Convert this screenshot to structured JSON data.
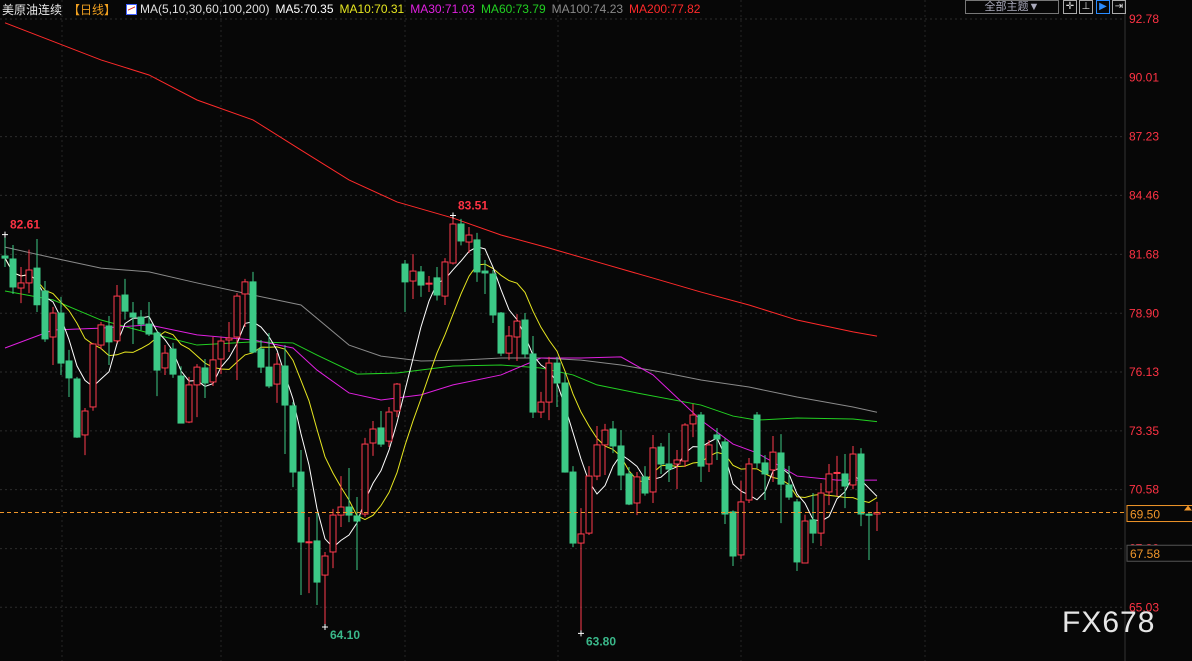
{
  "legend": {
    "title": "美原油连续",
    "period": "【日线】",
    "ma_params": "MA(5,10,30,60,100,200)",
    "ma5": "MA5:70.35",
    "ma10": "MA10:70.31",
    "ma30": "MA30:71.03",
    "ma60": "MA60:73.79",
    "ma100": "MA100:74.23",
    "ma200": "MA200:77.82"
  },
  "toolbar": {
    "themes": "全部主题▼",
    "icons": [
      "crosshair-icon",
      "range-icon",
      "play-forward-icon",
      "move-right-icon"
    ]
  },
  "watermark": "FX678",
  "colors": {
    "up": "#ff3b4e",
    "down": "#3cc986",
    "ma5": "#ffffff",
    "ma10": "#e6e620",
    "ma30": "#e020e0",
    "ma60": "#22d022",
    "ma100": "#8a8a8a",
    "ma200": "#ff2a2a",
    "last_price": "#f0962a",
    "axis": "#ff3344"
  },
  "chart_data": {
    "type": "candlestick",
    "title": "",
    "ylim": [
      63.5,
      92.78
    ],
    "y_ticks": [
      "92.78",
      "90.01",
      "87.23",
      "84.46",
      "81.68",
      "78.90",
      "76.13",
      "73.35",
      "70.58",
      "67.80",
      "65.03"
    ],
    "last_price": "69.50",
    "extra_price_label": "67.58",
    "annotations": {
      "high_left": "82.61",
      "high_mid": "83.51",
      "low_left": "64.10",
      "low_mid": "63.80"
    },
    "ohlc": [
      [
        81.6,
        82.61,
        81.08,
        81.5
      ],
      [
        81.46,
        82.12,
        79.81,
        80.14
      ],
      [
        80.09,
        81.08,
        79.38,
        80.33
      ],
      [
        80.33,
        81.9,
        79.85,
        80.94
      ],
      [
        81.03,
        82.4,
        78.96,
        79.3
      ],
      [
        79.95,
        80.42,
        77.55,
        77.69
      ],
      [
        77.78,
        79.2,
        76.46,
        78.91
      ],
      [
        78.91,
        79.67,
        75.99,
        76.55
      ],
      [
        76.65,
        77.17,
        74.95,
        75.85
      ],
      [
        75.8,
        75.9,
        73.02,
        73.06
      ],
      [
        73.16,
        74.43,
        72.21,
        74.29
      ],
      [
        74.48,
        77.5,
        74.3,
        77.45
      ],
      [
        77.4,
        78.49,
        77.2,
        78.35
      ],
      [
        78.3,
        78.77,
        76.46,
        77.55
      ],
      [
        77.6,
        80.23,
        77.5,
        79.71
      ],
      [
        79.76,
        80.52,
        78.6,
        79.0
      ],
      [
        78.91,
        79.43,
        77.45,
        78.72
      ],
      [
        78.72,
        79.05,
        78.1,
        78.39
      ],
      [
        78.39,
        79.43,
        77.83,
        77.92
      ],
      [
        77.97,
        78.1,
        74.99,
        76.22
      ],
      [
        76.32,
        77.4,
        75.99,
        77.02
      ],
      [
        77.21,
        77.5,
        75.85,
        76.03
      ],
      [
        75.94,
        76.4,
        73.7,
        73.72
      ],
      [
        73.77,
        75.9,
        73.72,
        75.52
      ],
      [
        75.52,
        76.5,
        74.0,
        76.36
      ],
      [
        76.32,
        76.74,
        74.9,
        75.61
      ],
      [
        75.66,
        77.78,
        75.47,
        76.7
      ],
      [
        76.74,
        77.78,
        76.03,
        77.59
      ],
      [
        77.64,
        78.49,
        77.07,
        77.73
      ],
      [
        77.78,
        79.85,
        75.75,
        79.71
      ],
      [
        79.81,
        80.52,
        78.25,
        80.38
      ],
      [
        80.38,
        80.85,
        77.02,
        77.07
      ],
      [
        77.21,
        77.64,
        76.08,
        76.36
      ],
      [
        76.36,
        77.97,
        75.37,
        75.47
      ],
      [
        75.56,
        77.02,
        74.67,
        76.5
      ],
      [
        76.41,
        77.4,
        72.26,
        74.57
      ],
      [
        74.53,
        74.71,
        70.7,
        71.41
      ],
      [
        71.41,
        72.45,
        65.61,
        68.11
      ],
      [
        68.08,
        69.29,
        65.7,
        68.12
      ],
      [
        68.16,
        69.48,
        65.14,
        66.22
      ],
      [
        66.55,
        67.64,
        64.1,
        67.45
      ],
      [
        67.64,
        69.67,
        66.88,
        69.38
      ],
      [
        69.38,
        71.22,
        68.82,
        69.76
      ],
      [
        69.76,
        71.6,
        69.05,
        69.38
      ],
      [
        69.34,
        70.23,
        66.79,
        69.1
      ],
      [
        69.43,
        73.02,
        69.3,
        72.73
      ],
      [
        72.78,
        73.82,
        72.17,
        73.44
      ],
      [
        73.49,
        74.29,
        72.6,
        72.73
      ],
      [
        72.87,
        74.48,
        72.59,
        74.24
      ],
      [
        74.29,
        75.61,
        74.0,
        75.56
      ],
      [
        81.22,
        81.41,
        78.96,
        80.38
      ],
      [
        80.42,
        81.69,
        79.57,
        80.89
      ],
      [
        80.85,
        81.13,
        79.67,
        80.23
      ],
      [
        80.28,
        80.66,
        79.9,
        80.32
      ],
      [
        80.57,
        81.08,
        79.5,
        79.76
      ],
      [
        79.71,
        81.5,
        79.29,
        81.32
      ],
      [
        81.27,
        83.51,
        81.2,
        83.11
      ],
      [
        83.11,
        83.35,
        82.1,
        82.31
      ],
      [
        82.26,
        82.97,
        81.74,
        82.59
      ],
      [
        82.36,
        82.69,
        80.38,
        80.85
      ],
      [
        80.89,
        81.41,
        79.81,
        80.8
      ],
      [
        80.75,
        80.94,
        78.44,
        78.82
      ],
      [
        78.91,
        78.96,
        76.88,
        77.02
      ],
      [
        77.02,
        78.3,
        76.69,
        77.83
      ],
      [
        77.78,
        78.86,
        76.65,
        78.53
      ],
      [
        78.58,
        78.91,
        76.8,
        76.98
      ],
      [
        76.98,
        77.83,
        73.96,
        74.24
      ],
      [
        74.24,
        75.19,
        73.96,
        74.71
      ],
      [
        74.71,
        76.84,
        73.86,
        76.55
      ],
      [
        76.55,
        76.84,
        74.48,
        75.61
      ],
      [
        75.61,
        76.1,
        71.38,
        71.41
      ],
      [
        71.41,
        71.69,
        67.87,
        68.06
      ],
      [
        68.06,
        69.71,
        63.8,
        68.49
      ],
      [
        68.53,
        71.69,
        68.44,
        71.22
      ],
      [
        71.22,
        73.58,
        71.03,
        72.69
      ],
      [
        72.69,
        73.68,
        71.27,
        73.39
      ],
      [
        73.44,
        73.82,
        72.3,
        72.64
      ],
      [
        72.64,
        73.39,
        70.56,
        71.27
      ],
      [
        71.32,
        71.65,
        69.85,
        69.9
      ],
      [
        69.95,
        71.41,
        69.38,
        71.18
      ],
      [
        71.18,
        71.69,
        70.3,
        70.42
      ],
      [
        70.47,
        73.16,
        69.95,
        72.55
      ],
      [
        72.59,
        72.78,
        71.32,
        71.79
      ],
      [
        71.79,
        73.25,
        70.94,
        71.55
      ],
      [
        71.79,
        72.45,
        70.61,
        71.98
      ],
      [
        71.93,
        73.72,
        71.65,
        73.63
      ],
      [
        73.68,
        74.62,
        73.06,
        74.1
      ],
      [
        74.1,
        74.24,
        70.94,
        71.69
      ],
      [
        71.79,
        72.92,
        71.41,
        72.69
      ],
      [
        73.16,
        73.49,
        71.98,
        72.97
      ],
      [
        72.83,
        73.0,
        68.96,
        69.43
      ],
      [
        69.53,
        69.6,
        66.98,
        67.45
      ],
      [
        67.5,
        71.0,
        67.3,
        70.0
      ],
      [
        70.09,
        72.07,
        69.95,
        71.79
      ],
      [
        74.1,
        74.24,
        71.6,
        71.84
      ],
      [
        71.84,
        72.21,
        70.09,
        71.32
      ],
      [
        71.51,
        73.11,
        70.94,
        72.35
      ],
      [
        72.31,
        73.2,
        69.0,
        70.84
      ],
      [
        70.8,
        71.7,
        70.1,
        70.23
      ],
      [
        70.0,
        70.14,
        66.74,
        67.17
      ],
      [
        67.12,
        69.4,
        67.1,
        69.1
      ],
      [
        69.15,
        70.42,
        68.06,
        68.53
      ],
      [
        68.53,
        70.89,
        67.92,
        70.42
      ],
      [
        70.47,
        71.79,
        69.85,
        71.32
      ],
      [
        71.35,
        72.17,
        70.28,
        71.39
      ],
      [
        71.32,
        72.26,
        69.71,
        70.75
      ],
      [
        70.8,
        72.64,
        70.6,
        72.26
      ],
      [
        72.26,
        72.54,
        68.86,
        69.43
      ],
      [
        69.42,
        69.53,
        67.26,
        69.38
      ],
      [
        69.43,
        70.0,
        68.63,
        69.5
      ]
    ],
    "ma_series": {
      "ma200": [
        [
          0,
          92.6
        ],
        [
          12,
          90.85
        ],
        [
          18,
          90.14
        ],
        [
          24,
          88.96
        ],
        [
          31,
          88.02
        ],
        [
          37,
          86.6
        ],
        [
          43,
          85.19
        ],
        [
          49,
          84.15
        ],
        [
          56,
          83.39
        ],
        [
          62,
          82.59
        ],
        [
          68,
          81.98
        ],
        [
          74,
          81.32
        ],
        [
          81,
          80.56
        ],
        [
          87,
          79.9
        ],
        [
          93,
          79.29
        ],
        [
          99,
          78.58
        ],
        [
          106,
          78.02
        ],
        [
          109,
          77.82
        ]
      ],
      "ma100": [
        [
          0,
          82.02
        ],
        [
          6,
          81.51
        ],
        [
          12,
          81.03
        ],
        [
          18,
          80.85
        ],
        [
          24,
          80.33
        ],
        [
          31,
          79.76
        ],
        [
          37,
          79.29
        ],
        [
          43,
          77.4
        ],
        [
          47,
          76.88
        ],
        [
          52,
          76.65
        ],
        [
          57,
          76.69
        ],
        [
          62,
          76.79
        ],
        [
          67,
          76.79
        ],
        [
          72,
          76.69
        ],
        [
          77,
          76.46
        ],
        [
          82,
          76.13
        ],
        [
          87,
          75.75
        ],
        [
          93,
          75.42
        ],
        [
          99,
          74.95
        ],
        [
          106,
          74.48
        ],
        [
          109,
          74.23
        ]
      ],
      "ma60": [
        [
          0,
          79.95
        ],
        [
          6,
          79.53
        ],
        [
          12,
          78.58
        ],
        [
          18,
          77.97
        ],
        [
          24,
          77.4
        ],
        [
          31,
          77.55
        ],
        [
          36,
          77.5
        ],
        [
          39,
          76.93
        ],
        [
          44,
          76.03
        ],
        [
          49,
          76.08
        ],
        [
          56,
          76.41
        ],
        [
          62,
          76.46
        ],
        [
          67,
          76.32
        ],
        [
          71,
          75.99
        ],
        [
          74,
          75.52
        ],
        [
          79,
          75.14
        ],
        [
          87,
          74.57
        ],
        [
          91,
          74.05
        ],
        [
          94,
          73.86
        ],
        [
          99,
          73.96
        ],
        [
          106,
          73.91
        ],
        [
          109,
          73.79
        ]
      ],
      "ma30": [
        [
          0,
          77.26
        ],
        [
          6,
          78.11
        ],
        [
          12,
          78.2
        ],
        [
          18,
          78.35
        ],
        [
          24,
          77.88
        ],
        [
          31,
          77.64
        ],
        [
          36,
          77.26
        ],
        [
          39,
          76.22
        ],
        [
          43,
          75.14
        ],
        [
          47,
          74.81
        ],
        [
          52,
          75.05
        ],
        [
          56,
          75.52
        ],
        [
          62,
          75.99
        ],
        [
          67,
          76.79
        ],
        [
          72,
          76.79
        ],
        [
          77,
          76.84
        ],
        [
          81,
          75.99
        ],
        [
          87,
          73.86
        ],
        [
          91,
          72.73
        ],
        [
          94,
          72.31
        ],
        [
          99,
          71.22
        ],
        [
          104,
          71.03
        ],
        [
          109,
          71.03
        ]
      ]
    }
  }
}
